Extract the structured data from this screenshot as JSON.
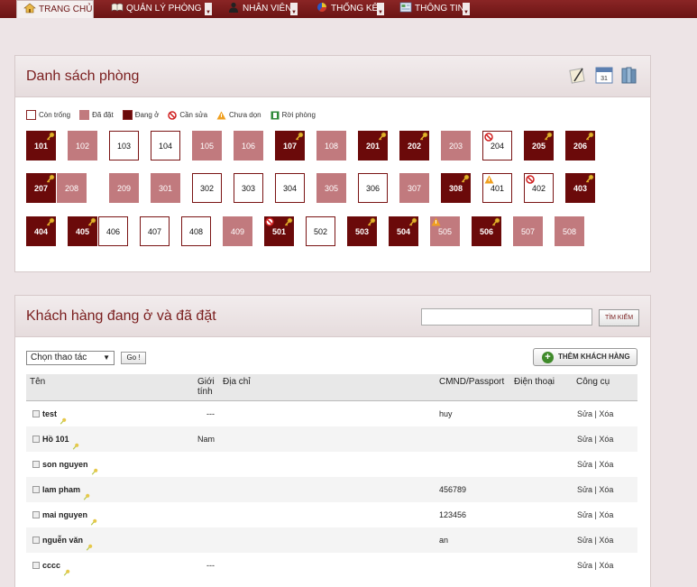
{
  "nav": {
    "tabs": [
      {
        "label": "TRANG CHỦ",
        "icon": "home-icon"
      },
      {
        "label": "QUẢN LÝ PHÒNG",
        "icon": "book-icon"
      },
      {
        "label": "NHÂN VIÊN",
        "icon": "person-icon"
      },
      {
        "label": "THỐNG KÊ",
        "icon": "pie-chart-icon"
      },
      {
        "label": "THÔNG TIN",
        "icon": "info-icon"
      }
    ]
  },
  "rooms_panel": {
    "title": "Danh sách phòng",
    "legend": [
      "Còn trống",
      "Đã đặt",
      "Đang ở",
      "Cần sửa",
      "Chưa dọn",
      "Rời phòng"
    ],
    "rooms": [
      {
        "number": "101",
        "status": "occupied",
        "flag": "key"
      },
      {
        "number": "102",
        "status": "booked"
      },
      {
        "number": "103",
        "status": "empty"
      },
      {
        "number": "104",
        "status": "empty"
      },
      {
        "number": "105",
        "status": "booked"
      },
      {
        "number": "106",
        "status": "booked"
      },
      {
        "number": "107",
        "status": "occupied",
        "flag": "key"
      },
      {
        "number": "108",
        "status": "booked"
      },
      {
        "number": "201",
        "status": "occupied",
        "flag": "key"
      },
      {
        "number": "202",
        "status": "occupied",
        "flag": "key"
      },
      {
        "number": "203",
        "status": "booked"
      },
      {
        "number": "204",
        "status": "empty",
        "flag": "no"
      },
      {
        "number": "205",
        "status": "occupied",
        "flag": "key"
      },
      {
        "number": "206",
        "status": "occupied",
        "flag": "key"
      },
      {
        "number": "207",
        "status": "occupied",
        "flag": "key"
      },
      {
        "number": "208",
        "status": "booked"
      },
      {
        "number": "209",
        "status": "booked"
      },
      {
        "number": "301",
        "status": "booked"
      },
      {
        "number": "302",
        "status": "empty"
      },
      {
        "number": "303",
        "status": "empty"
      },
      {
        "number": "304",
        "status": "empty"
      },
      {
        "number": "305",
        "status": "booked"
      },
      {
        "number": "306",
        "status": "empty"
      },
      {
        "number": "307",
        "status": "booked"
      },
      {
        "number": "308",
        "status": "occupied",
        "flag": "key"
      },
      {
        "number": "401",
        "status": "empty",
        "flag": "warn"
      },
      {
        "number": "402",
        "status": "empty",
        "flag": "no"
      },
      {
        "number": "403",
        "status": "occupied",
        "flag": "key"
      },
      {
        "number": "404",
        "status": "occupied",
        "flag": "key"
      },
      {
        "number": "405",
        "status": "occupied",
        "flag": "key"
      },
      {
        "number": "406",
        "status": "empty"
      },
      {
        "number": "407",
        "status": "empty"
      },
      {
        "number": "408",
        "status": "empty"
      },
      {
        "number": "409",
        "status": "booked"
      },
      {
        "number": "501",
        "status": "occupied",
        "flag": "nokey"
      },
      {
        "number": "502",
        "status": "empty"
      },
      {
        "number": "503",
        "status": "occupied",
        "flag": "key"
      },
      {
        "number": "504",
        "status": "occupied",
        "flag": "key"
      },
      {
        "number": "505",
        "status": "booked",
        "flag": "warn"
      },
      {
        "number": "506",
        "status": "occupied",
        "flag": "key"
      },
      {
        "number": "507",
        "status": "booked"
      },
      {
        "number": "508",
        "status": "booked"
      }
    ]
  },
  "customers_panel": {
    "title": "Khách hàng đang ở và đã đặt",
    "search_value": "",
    "search_button": "TÌM KIẾM",
    "action_select": "Chọn thao tác",
    "go_button": "Go !",
    "add_button": "THÊM KHÁCH HÀNG",
    "columns": [
      "Tên",
      "Giới tính",
      "Địa chỉ",
      "CMND/Passport",
      "Điện thoại",
      "Công cụ"
    ],
    "edit_label": "Sửa",
    "delete_label": "Xóa",
    "rows": [
      {
        "name": "test",
        "gender": "---",
        "address": "",
        "id": "huy",
        "phone": ""
      },
      {
        "name": "Hồ 101",
        "gender": "Nam",
        "address": "",
        "id": "",
        "phone": ""
      },
      {
        "name": "son nguyen",
        "gender": "",
        "address": "",
        "id": "",
        "phone": ""
      },
      {
        "name": "lam pham",
        "gender": "",
        "address": "",
        "id": "456789",
        "phone": ""
      },
      {
        "name": "mai nguyen",
        "gender": "",
        "address": "",
        "id": "123456",
        "phone": ""
      },
      {
        "name": "nguễn văn",
        "gender": "",
        "address": "",
        "id": "an",
        "phone": ""
      },
      {
        "name": "cccc",
        "gender": "---",
        "address": "",
        "id": "",
        "phone": ""
      }
    ]
  }
}
